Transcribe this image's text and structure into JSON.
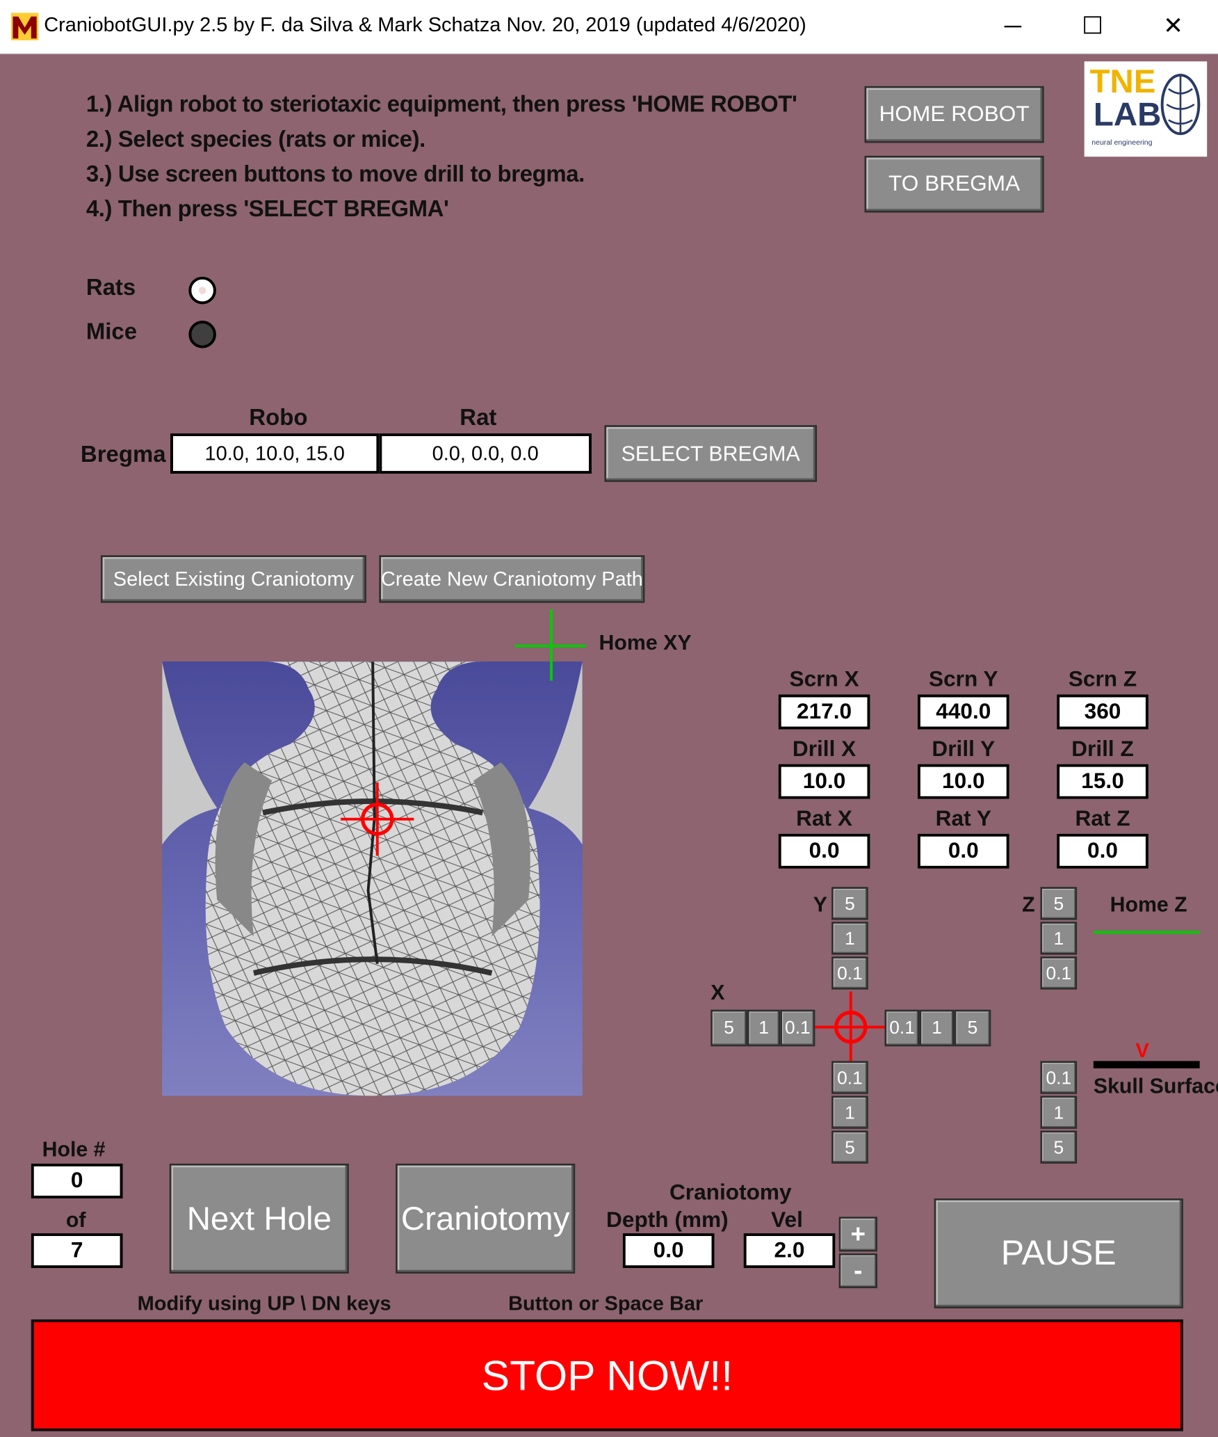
{
  "window": {
    "title": "CraniobotGUI.py 2.5 by F. da Silva & Mark Schatza Nov. 20, 2019 (updated 4/6/2020)",
    "app_icon": "m-logo-icon",
    "controls": {
      "minimize": "─",
      "maximize": "☐",
      "close": "✕"
    }
  },
  "logo": {
    "line1": "TNE",
    "line2": "LAB",
    "tagline": "neural engineering"
  },
  "instructions": [
    "1.) Align robot to steriotaxic equipment, then press 'HOME ROBOT'",
    "2.) Select species (rats or mice).",
    "3.) Use screen buttons to move drill to bregma.",
    "4.) Then press 'SELECT BREGMA'"
  ],
  "buttons": {
    "home_robot": "HOME ROBOT",
    "to_bregma": "TO BREGMA",
    "select_bregma": "SELECT BREGMA",
    "select_existing": "Select Existing Craniotomy",
    "create_new": "Create New Craniotomy Path",
    "next_hole": "Next Hole",
    "craniotomy": "Craniotomy",
    "pause": "PAUSE",
    "stop": "STOP NOW!!",
    "plus": "+",
    "minus": "-"
  },
  "species": {
    "rats_label": "Rats",
    "mice_label": "Mice",
    "selected": "Rats"
  },
  "bregma": {
    "label": "Bregma",
    "robo_header": "Robo",
    "rat_header": "Rat",
    "robo_value": "10.0, 10.0, 15.0",
    "rat_value": "0.0, 0.0, 0.0"
  },
  "home_xy_label": "Home XY",
  "coords": {
    "scrn_x_label": "Scrn X",
    "scrn_x": "217.0",
    "scrn_y_label": "Scrn Y",
    "scrn_y": "440.0",
    "scrn_z_label": "Scrn Z",
    "scrn_z": "360",
    "drill_x_label": "Drill X",
    "drill_x": "10.0",
    "drill_y_label": "Drill Y",
    "drill_y": "10.0",
    "drill_z_label": "Drill Z",
    "drill_z": "15.0",
    "rat_x_label": "Rat X",
    "rat_x": "0.0",
    "rat_y_label": "Rat Y",
    "rat_y": "0.0",
    "rat_z_label": "Rat Z",
    "rat_z": "0.0"
  },
  "jog": {
    "y_label": "Y",
    "x_label": "X",
    "z_label": "Z",
    "steps": [
      "5",
      "1",
      "0.1"
    ],
    "home_z_label": "Home Z",
    "skull_surface_label": "Skull Surface",
    "skull_marker": "V"
  },
  "hole": {
    "label": "Hole #",
    "current": "0",
    "of_label": "of",
    "total": "7",
    "hint": "Modify using UP \\ DN keys"
  },
  "craniotomy": {
    "title": "Craniotomy",
    "depth_label": "Depth (mm)",
    "vel_label": "Vel",
    "depth": "0.0",
    "vel": "2.0",
    "hint": "Button or Space Bar"
  },
  "colors": {
    "background": "#8d6470",
    "button": "#8c8c8c",
    "stop": "#ff0000",
    "crosshair_red": "#ff0000",
    "crosshair_green": "#00cc00"
  }
}
